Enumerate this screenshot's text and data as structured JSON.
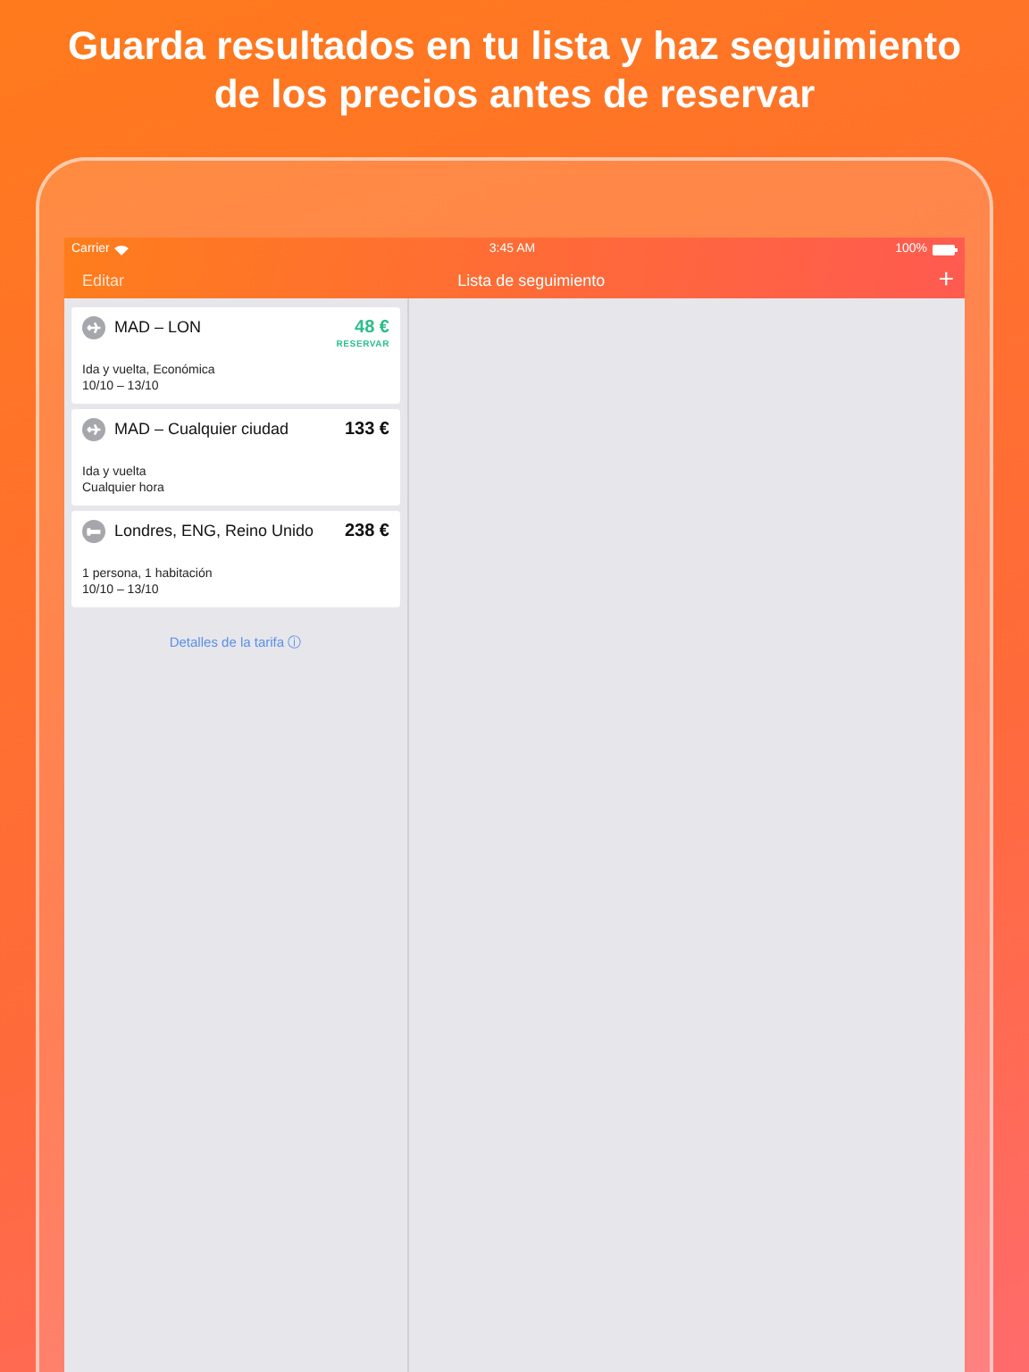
{
  "headline": "Guarda resultados en tu lista y haz seguimiento de los precios antes de reservar",
  "status_bar": {
    "carrier": "Carrier",
    "time": "3:45 AM",
    "battery": "100%"
  },
  "nav": {
    "left": "Editar",
    "title": "Lista de seguimiento",
    "right": "+"
  },
  "cards": [
    {
      "kind": "flight",
      "title": "MAD – LON",
      "price": "48 €",
      "deal": true,
      "action": "RESERVAR",
      "lines": [
        "Ida y vuelta, Económica",
        "10/10 – 13/10"
      ]
    },
    {
      "kind": "flight",
      "title": "MAD – Cualquier ciudad",
      "price": "133 €",
      "deal": false,
      "lines": [
        "Ida y vuelta",
        "Cualquier hora"
      ]
    },
    {
      "kind": "hotel",
      "title": "Londres, ENG, Reino Unido",
      "price": "238 €",
      "deal": false,
      "lines": [
        "1 persona, 1 habitación",
        "10/10 – 13/10"
      ]
    }
  ],
  "footer_link": "Detalles de la tarifa ⓘ"
}
